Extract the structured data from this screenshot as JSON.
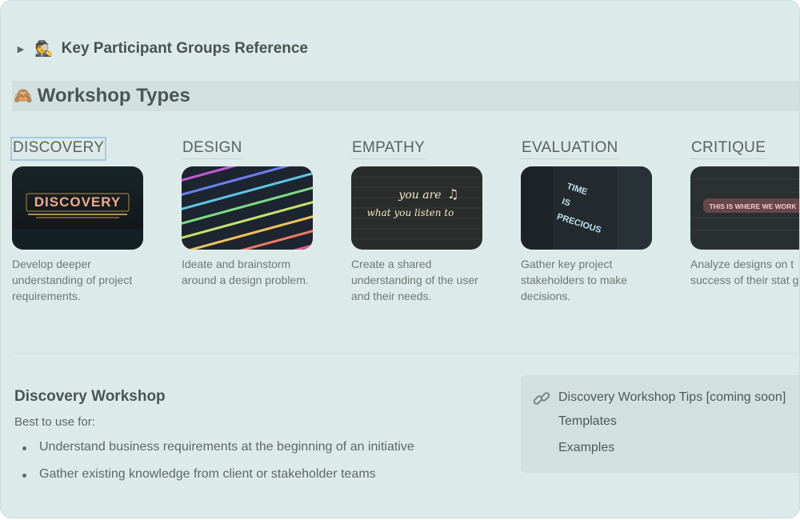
{
  "toggle": {
    "label": "Key Participant Groups Reference",
    "emoji": "🕵️"
  },
  "section_header": {
    "emoji": "🙈",
    "label": "Workshop Types"
  },
  "workshop_cards": [
    {
      "title": "DISCOVERY",
      "description": "Develop deeper understanding of project requirements."
    },
    {
      "title": "DESIGN",
      "description": "Ideate and brainstorm around a design problem."
    },
    {
      "title": "EMPATHY",
      "description": "Create a shared understanding of the user and their needs."
    },
    {
      "title": "EVALUATION",
      "description": "Gather key project stakeholders to make decisions."
    },
    {
      "title": "CRITIQUE",
      "description": "Analyze designs on t success of their stat goal."
    }
  ],
  "thumb_text": {
    "discovery": "DISCOVERY",
    "empathy_line1": "you are",
    "empathy_line2": "what you listen to",
    "evaluation_line1": "TIME",
    "evaluation_line2": "IS",
    "evaluation_line3": "PRECIOUS",
    "critique": "THIS IS WHERE WE WORK"
  },
  "detail": {
    "title": "Discovery Workshop",
    "subtitle": "Best to use for:",
    "bullets": [
      "Understand business requirements at the beginning of an initiative",
      "Gather existing knowledge from client or stakeholder teams"
    ]
  },
  "links_panel": {
    "icon": "link-icon",
    "items": [
      "Discovery Workshop Tips [coming soon]",
      "Templates",
      "Examples"
    ]
  },
  "colors": {
    "background": "#dcebe9",
    "band": "#d2e1df",
    "selection_outline": "#a8c7e6"
  }
}
